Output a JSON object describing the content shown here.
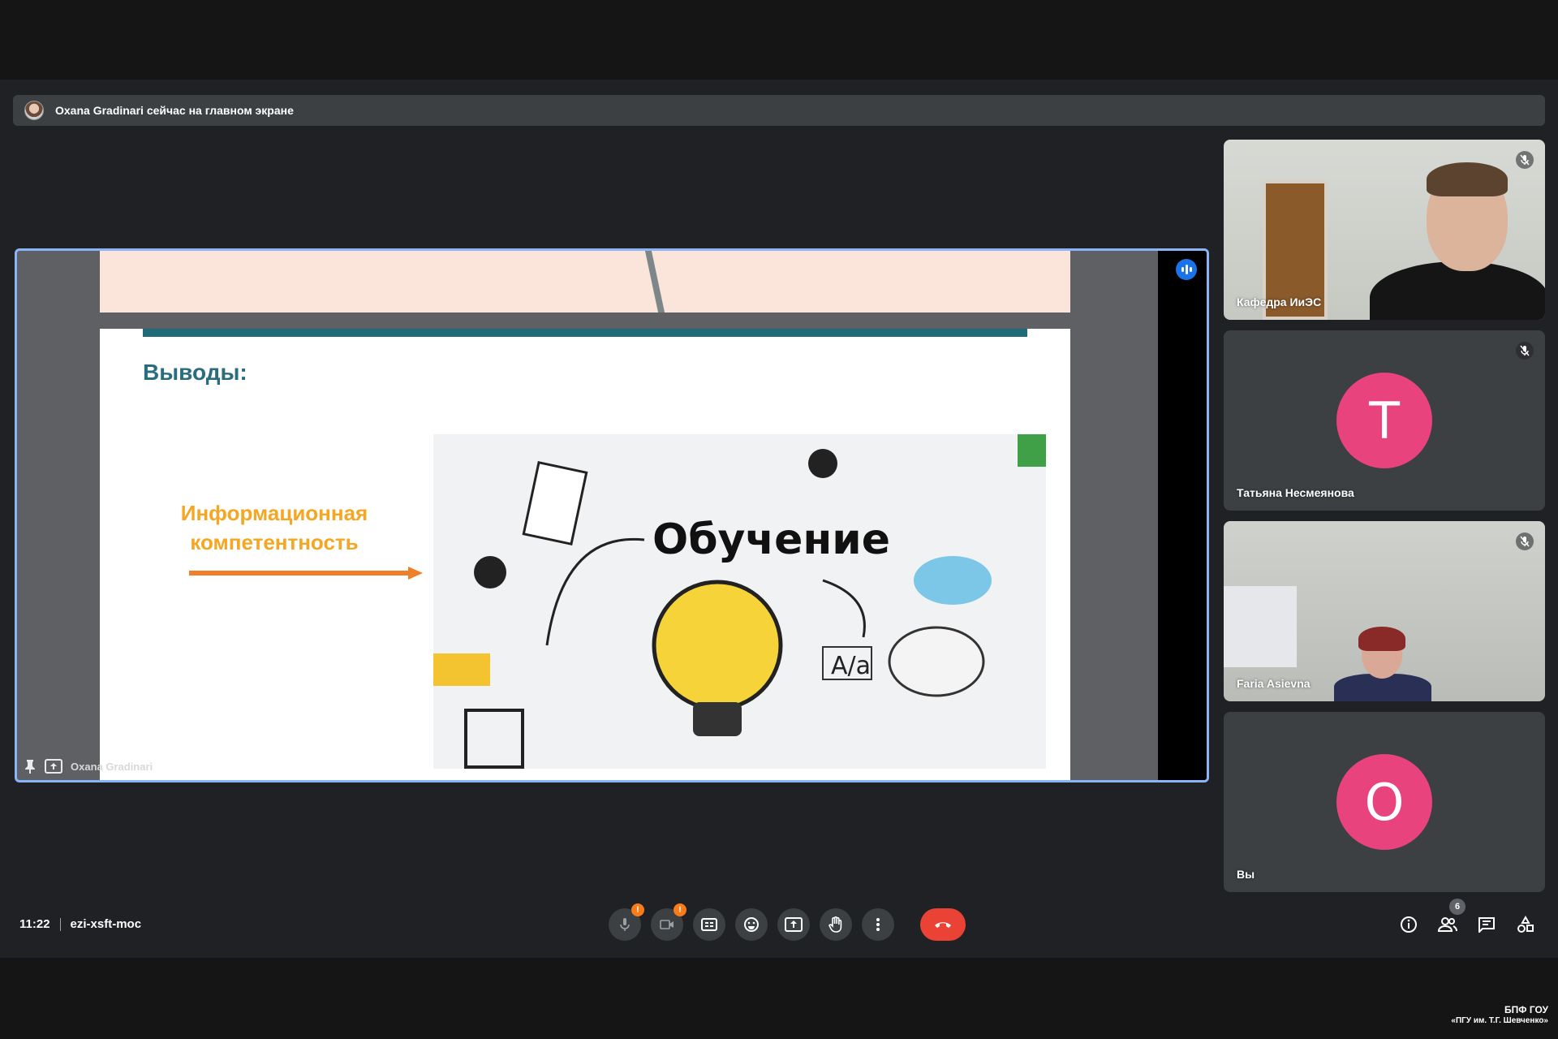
{
  "banner": {
    "text": "Oxana Gradinari сейчас на главном экране"
  },
  "presentation": {
    "presenter_name": "Oxana Gradinari",
    "slide_title": "Выводы:",
    "slide_label_line1": "Информационная",
    "slide_label_line2": "компетентность",
    "slide_image_word": "Обучение"
  },
  "participants": [
    {
      "name": "Кафедра ИиЭС",
      "muted": true,
      "video": true
    },
    {
      "name": "Татьяна Несмеянова",
      "muted": true,
      "video": false,
      "initial": "Т"
    },
    {
      "name": "Faria Asievna",
      "muted": true,
      "video": true
    },
    {
      "name": "Вы",
      "muted": false,
      "video": false,
      "initial": "О"
    }
  ],
  "meeting": {
    "time": "11:22",
    "code": "ezi-xsft-moc"
  },
  "controls": {
    "mic_badge": "!",
    "camera_badge": "!",
    "participants_count": "6"
  },
  "watermark": {
    "line1": "БПФ ГОУ",
    "line2": "«ПГУ им. Т.Г. Шевченко»"
  },
  "colors": {
    "accent_blue": "#8ab4f8",
    "avatar_pink": "#e8437d",
    "end_call_red": "#ea4335",
    "warning_orange": "#fa7b17",
    "slide_title_teal": "#2a6d7e",
    "slide_label_orange": "#f5a623"
  },
  "icons": [
    "pin-icon",
    "present-icon",
    "speaking-icon",
    "mic-off-icon",
    "camera-off-icon",
    "captions-icon",
    "emoji-icon",
    "present-now-icon",
    "raise-hand-icon",
    "more-options-icon",
    "end-call-icon",
    "info-icon",
    "people-icon",
    "chat-icon",
    "activities-icon"
  ]
}
